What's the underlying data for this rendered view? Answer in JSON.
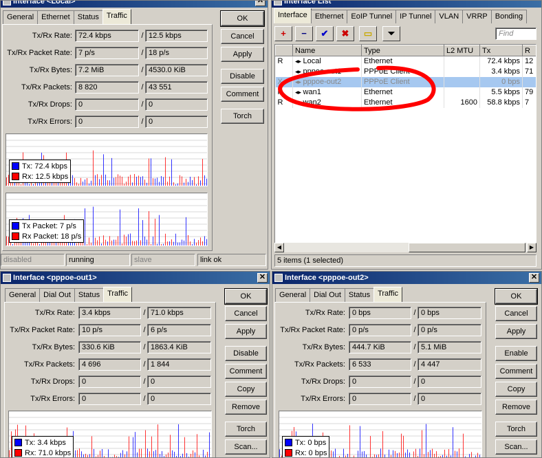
{
  "colors": {
    "tx": "#0000ff",
    "rx": "#ff0000",
    "annotation": "#ff0000"
  },
  "win_local": {
    "title": "Interface <Local>",
    "tabs": [
      "General",
      "Ethernet",
      "Status",
      "Traffic"
    ],
    "active_tab": "Traffic",
    "labels": {
      "tx_rx_rate": "Tx/Rx Rate:",
      "tx_rx_packet_rate": "Tx/Rx Packet Rate:",
      "tx_rx_bytes": "Tx/Rx Bytes:",
      "tx_rx_packets": "Tx/Rx Packets:",
      "tx_rx_drops": "Tx/Rx Drops:",
      "tx_rx_errors": "Tx/Rx Errors:"
    },
    "values": {
      "tx_rate": "72.4 kbps",
      "rx_rate": "12.5 kbps",
      "tx_packet_rate": "7 p/s",
      "rx_packet_rate": "18 p/s",
      "tx_bytes": "7.2 MiB",
      "rx_bytes": "4530.0 KiB",
      "tx_packets": "8 820",
      "rx_packets": "43 551",
      "tx_drops": "0",
      "rx_drops": "0",
      "tx_errors": "0",
      "rx_errors": "0"
    },
    "buttons": {
      "ok": "OK",
      "cancel": "Cancel",
      "apply": "Apply",
      "disable": "Disable",
      "comment": "Comment",
      "torch": "Torch"
    },
    "legend_rate": {
      "tx": "Tx:  72.4 kbps",
      "rx": "Rx:  12.5 kbps"
    },
    "legend_packet": {
      "tx": "Tx Packet:  7 p/s",
      "rx": "Rx Packet:  18 p/s"
    },
    "status": {
      "s1": "disabled",
      "s2": "running",
      "s3": "slave",
      "s4": "link ok"
    }
  },
  "win_list": {
    "title": "Interface List",
    "tabs": [
      "Interface",
      "Ethernet",
      "EoIP Tunnel",
      "IP Tunnel",
      "VLAN",
      "VRRP",
      "Bonding"
    ],
    "active_tab": "Interface",
    "find_placeholder": "Find",
    "columns": {
      "flag": "",
      "name": "Name",
      "type": "Type",
      "l2mtu": "L2 MTU",
      "tx": "Tx",
      "rx": "R"
    },
    "rows": [
      {
        "flag": "R",
        "name": "Local",
        "type": "Ethernet",
        "l2mtu": "",
        "tx": "72.4 kbps",
        "rx": "12"
      },
      {
        "flag": "",
        "name": "pppoe-out1",
        "type": "PPPoE Client",
        "l2mtu": "",
        "tx": "3.4 kbps",
        "rx": "71"
      },
      {
        "flag": "X",
        "name": "pppoe-out2",
        "type": "PPPoE Client",
        "l2mtu": "",
        "tx": "0 bps",
        "rx": ""
      },
      {
        "flag": "R",
        "name": "wan1",
        "type": "Ethernet",
        "l2mtu": "",
        "tx": "5.5 kbps",
        "rx": "79"
      },
      {
        "flag": "R",
        "name": "wan2",
        "type": "Ethernet",
        "l2mtu": "1600",
        "tx": "58.8 kbps",
        "rx": "7"
      }
    ],
    "status": "5 items (1 selected)"
  },
  "win_out1": {
    "title": "Interface <pppoe-out1>",
    "tabs": [
      "General",
      "Dial Out",
      "Status",
      "Traffic"
    ],
    "active_tab": "Traffic",
    "values": {
      "tx_rate": "3.4 kbps",
      "rx_rate": "71.0 kbps",
      "tx_packet_rate": "10 p/s",
      "rx_packet_rate": "6 p/s",
      "tx_bytes": "330.6 KiB",
      "rx_bytes": "1863.4 KiB",
      "tx_packets": "4 696",
      "rx_packets": "1 844",
      "tx_drops": "0",
      "rx_drops": "0",
      "tx_errors": "0",
      "rx_errors": "0"
    },
    "buttons": {
      "ok": "OK",
      "cancel": "Cancel",
      "apply": "Apply",
      "toggle": "Disable",
      "comment": "Comment",
      "copy": "Copy",
      "remove": "Remove",
      "torch": "Torch",
      "scan": "Scan..."
    },
    "legend_rate": {
      "tx": "Tx:  3.4 kbps",
      "rx": "Rx:  71.0 kbps"
    }
  },
  "win_out2": {
    "title": "Interface <pppoe-out2>",
    "tabs": [
      "General",
      "Dial Out",
      "Status",
      "Traffic"
    ],
    "active_tab": "Traffic",
    "values": {
      "tx_rate": "0 bps",
      "rx_rate": "0 bps",
      "tx_packet_rate": "0 p/s",
      "rx_packet_rate": "0 p/s",
      "tx_bytes": "444.7 KiB",
      "rx_bytes": "5.1 MiB",
      "tx_packets": "6 533",
      "rx_packets": "4 447",
      "tx_drops": "0",
      "rx_drops": "0",
      "tx_errors": "0",
      "rx_errors": "0"
    },
    "buttons": {
      "ok": "OK",
      "cancel": "Cancel",
      "apply": "Apply",
      "toggle": "Enable",
      "comment": "Comment",
      "copy": "Copy",
      "remove": "Remove",
      "torch": "Torch",
      "scan": "Scan..."
    },
    "legend_rate": {
      "tx": "Tx:  0 bps",
      "rx": "Rx:  0 bps"
    }
  }
}
